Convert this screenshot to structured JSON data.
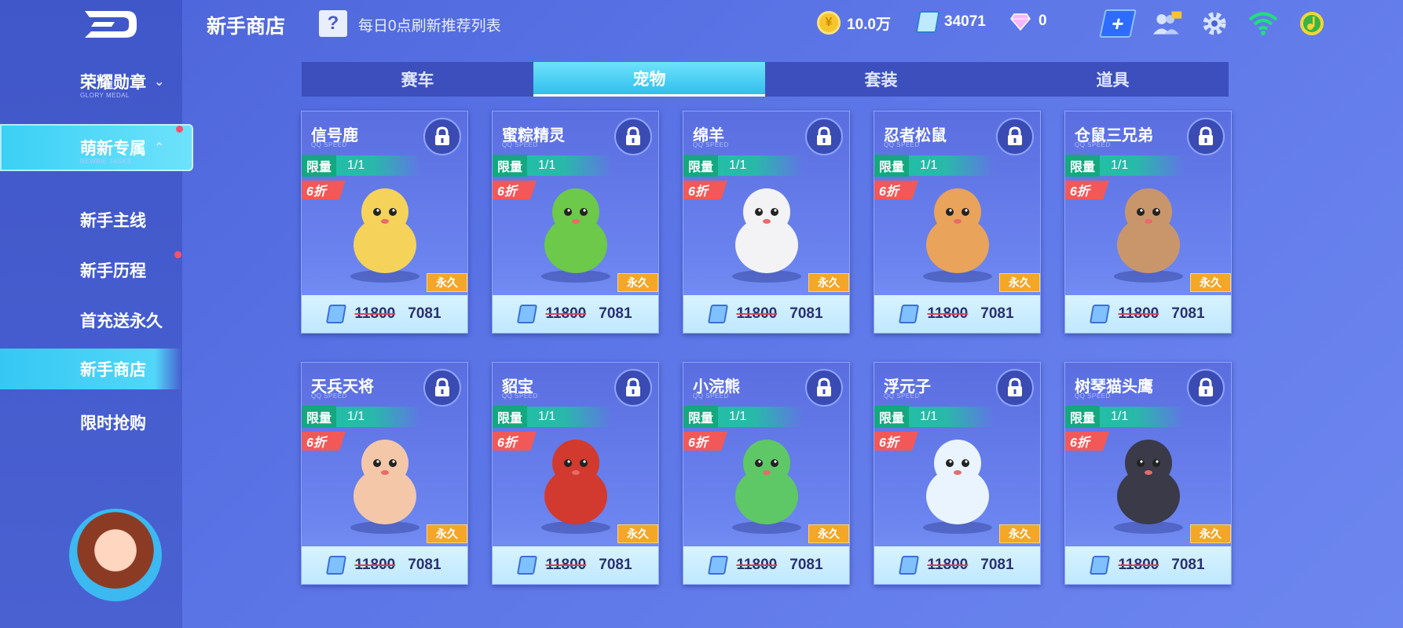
{
  "header": {
    "title": "新手商店",
    "help_label": "?",
    "subtitle": "每日0点刷新推荐列表",
    "coins": "10.0万",
    "tickets": "34071",
    "diamonds": "0"
  },
  "sidebar": {
    "items": [
      {
        "label": "荣耀勋章",
        "sub": "GLORY MEDAL"
      },
      {
        "label": "萌新专属",
        "sub": "NEWBIE TASKS"
      },
      {
        "label": "新手主线"
      },
      {
        "label": "新手历程"
      },
      {
        "label": "首充送永久"
      },
      {
        "label": "新手商店"
      },
      {
        "label": "限时抢购"
      }
    ]
  },
  "tabs": [
    "赛车",
    "宠物",
    "套装",
    "道具"
  ],
  "common": {
    "brand_sub": "QQ SPEED",
    "limit_label": "限量",
    "limit_count": "1/1",
    "discount": "6折",
    "permanent": "永久",
    "old_price": "11800",
    "new_price": "7081"
  },
  "cards": [
    {
      "name": "信号鹿",
      "color": "#f5d35a"
    },
    {
      "name": "蜜粽精灵",
      "color": "#6cc94a"
    },
    {
      "name": "绵羊",
      "color": "#f3f3f6"
    },
    {
      "name": "忍者松鼠",
      "color": "#e9a35a"
    },
    {
      "name": "仓鼠三兄弟",
      "color": "#c9966c"
    },
    {
      "name": "天兵天将",
      "color": "#f4c7a8"
    },
    {
      "name": "貂宝",
      "color": "#d23a2f"
    },
    {
      "name": "小浣熊",
      "color": "#5ec866"
    },
    {
      "name": "浮元子",
      "color": "#eaf4ff"
    },
    {
      "name": "树琴猫头鹰",
      "color": "#3a3a48"
    }
  ]
}
